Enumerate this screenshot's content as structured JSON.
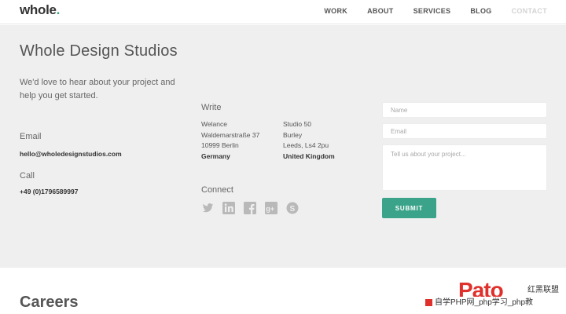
{
  "header": {
    "logo_text": "whole",
    "logo_dot": ".",
    "nav": [
      {
        "label": "WORK"
      },
      {
        "label": "ABOUT"
      },
      {
        "label": "SERVICES"
      },
      {
        "label": "BLOG"
      },
      {
        "label": "CONTACT"
      }
    ]
  },
  "contact": {
    "title": "Whole Design Studios",
    "intro": "We'd love to hear about your project and help you get started.",
    "email_label": "Email",
    "email_value": "hello@wholedesignstudios.com",
    "call_label": "Call",
    "call_value": "+49 (0)1796589997",
    "write_label": "Write",
    "address_1": [
      "Welance",
      "Waldemarstraße 37",
      "10999 Berlin",
      "Germany"
    ],
    "address_2": [
      "Studio 50",
      "Burley",
      "Leeds, Ls4 2pu",
      "United Kingdom"
    ],
    "connect_label": "Connect",
    "social_icons": [
      "twitter-icon",
      "linkedin-icon",
      "facebook-icon",
      "google-plus-icon",
      "skype-icon"
    ],
    "form": {
      "name_placeholder": "Name",
      "email_placeholder": "Email",
      "message_placeholder": "Tell us about your project...",
      "submit_label": "SUBMIT"
    }
  },
  "careers": {
    "title": "Careers"
  },
  "watermark": {
    "logo": "Pato",
    "cn_label": "红黑联盟",
    "bar_text": "自学PHP网_php学习_php教"
  },
  "colors": {
    "accent": "#3aa389",
    "background": "#efefef",
    "watermark": "#e0302b"
  }
}
